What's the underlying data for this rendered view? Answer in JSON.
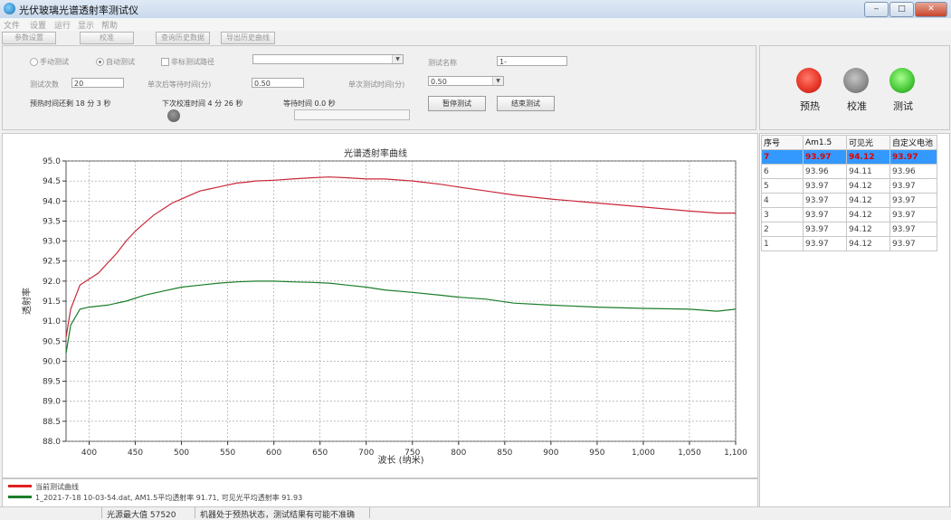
{
  "window": {
    "title": "光伏玻璃光谱透射率测试仪",
    "min": "‒",
    "max": "□",
    "close": "✕"
  },
  "menu": [
    "文件",
    "设置",
    "运行",
    "显示",
    "帮助"
  ],
  "toolbar": [
    "参数设置",
    "校准",
    "查询历史数据",
    "导出历史曲线"
  ],
  "controls": {
    "mode_manual": "手动测试",
    "mode_auto": "自动测试",
    "range_option": "非标测试路径",
    "path_value": "",
    "test_name_label": "测试名称",
    "test_name_value": "1-",
    "count_label": "测试次数",
    "count_value": "20",
    "single_wait_label": "单次后等待时间(分)",
    "single_wait_value": "0.50",
    "interval_label": "单次测试时间(分)",
    "interval_value": "0.50",
    "preheat_remaining": "预热时间还剩 18 分 3 秒",
    "next_calibration": "下次校准时间 4 分 26 秒",
    "wait_time": "等待时间 0.0 秒",
    "pause_button": "暂停测试",
    "stop_button": "结束测试"
  },
  "status": {
    "preheat": "预热",
    "calibrate": "校准",
    "test": "测试"
  },
  "colors": {
    "red": "#e8392a",
    "gray": "#8f8f8f",
    "green": "#4ccc3c",
    "curve_red": "#c8283a",
    "curve_green": "#1a7d28"
  },
  "table": {
    "headers": [
      "序号",
      "Am1.5",
      "可见光",
      "自定义电池"
    ],
    "rows": [
      [
        "7",
        "93.97",
        "94.12",
        "93.97"
      ],
      [
        "6",
        "93.96",
        "94.11",
        "93.96"
      ],
      [
        "5",
        "93.97",
        "94.12",
        "93.97"
      ],
      [
        "4",
        "93.97",
        "94.12",
        "93.97"
      ],
      [
        "3",
        "93.97",
        "94.12",
        "93.97"
      ],
      [
        "2",
        "93.97",
        "94.12",
        "93.97"
      ],
      [
        "1",
        "93.97",
        "94.12",
        "93.97"
      ]
    ]
  },
  "chart_data": {
    "type": "line",
    "title": "光谱透射率曲线",
    "xlabel": "波长 (纳米)",
    "ylabel": "透射率",
    "xlim": [
      375,
      1100
    ],
    "ylim": [
      88.0,
      95.0
    ],
    "xticks": [
      "400",
      "450",
      "500",
      "550",
      "600",
      "650",
      "700",
      "750",
      "800",
      "850",
      "900",
      "950",
      "1,000",
      "1,050",
      "1,100"
    ],
    "yticks": [
      "88.0",
      "88.5",
      "89.0",
      "89.5",
      "90.0",
      "90.5",
      "91.0",
      "91.5",
      "92.0",
      "92.5",
      "93.0",
      "93.5",
      "94.0",
      "94.5",
      "95.0"
    ],
    "grid": true,
    "series": [
      {
        "name": "当前测试曲线",
        "color": "red",
        "x": [
          375,
          380,
          390,
          400,
          410,
          420,
          430,
          440,
          450,
          460,
          470,
          480,
          490,
          500,
          510,
          520,
          530,
          540,
          550,
          560,
          570,
          580,
          600,
          620,
          640,
          660,
          680,
          700,
          720,
          750,
          780,
          800,
          830,
          860,
          900,
          950,
          1000,
          1050,
          1080,
          1100
        ],
        "y": [
          90.6,
          91.3,
          91.9,
          92.05,
          92.2,
          92.45,
          92.7,
          93.0,
          93.25,
          93.45,
          93.65,
          93.8,
          93.95,
          94.05,
          94.15,
          94.25,
          94.3,
          94.35,
          94.4,
          94.45,
          94.47,
          94.5,
          94.52,
          94.55,
          94.58,
          94.6,
          94.58,
          94.55,
          94.55,
          94.5,
          94.42,
          94.35,
          94.25,
          94.15,
          94.05,
          93.95,
          93.85,
          93.75,
          93.7,
          93.7
        ]
      },
      {
        "name": "1_2021-7-18 10-03-54.dat, AM1.5平均透射率 91.71, 可见光平均透射率 91.93",
        "color": "green",
        "x": [
          375,
          380,
          390,
          400,
          420,
          440,
          460,
          480,
          500,
          520,
          540,
          560,
          580,
          600,
          620,
          640,
          660,
          680,
          700,
          720,
          750,
          780,
          800,
          830,
          860,
          900,
          950,
          1000,
          1050,
          1080,
          1100
        ],
        "y": [
          90.2,
          90.9,
          91.3,
          91.35,
          91.4,
          91.5,
          91.65,
          91.75,
          91.85,
          91.9,
          91.95,
          91.98,
          92.0,
          92.0,
          91.98,
          91.97,
          91.95,
          91.9,
          91.85,
          91.78,
          91.72,
          91.65,
          91.6,
          91.55,
          91.45,
          91.4,
          91.35,
          91.32,
          91.3,
          91.25,
          91.3
        ]
      }
    ]
  },
  "statusbar": {
    "light_max": "光源最大值 57520",
    "message": "机器处于预热状态，测试结果有可能不准确"
  }
}
